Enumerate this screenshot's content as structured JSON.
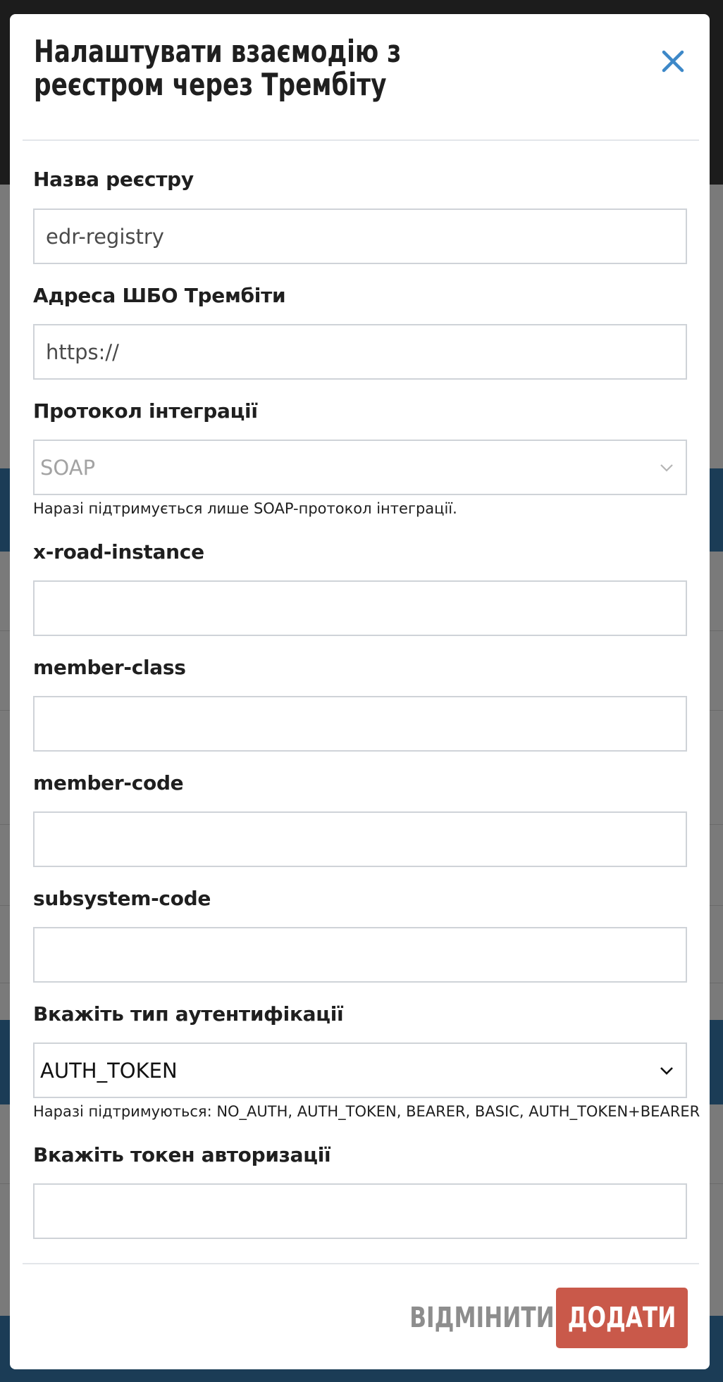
{
  "modal": {
    "title": "Налаштувати взаємодію з реєстром через Трембіту",
    "fields": {
      "registry_name": {
        "label": "Назва реєстру",
        "value": "edr-registry"
      },
      "trembita_address": {
        "label": "Адреса ШБО Трембіти",
        "value": "https://"
      },
      "protocol": {
        "label": "Протокол інтеграції",
        "selected": "SOAP",
        "hint": "Наразі підтримується лише SOAP-протокол інтеграції."
      },
      "x_road_instance": {
        "label": "x-road-instance",
        "value": ""
      },
      "member_class": {
        "label": "member-class",
        "value": ""
      },
      "member_code": {
        "label": "member-code",
        "value": ""
      },
      "subsystem_code": {
        "label": "subsystem-code",
        "value": ""
      },
      "auth_type": {
        "label": "Вкажіть тип аутентифікації",
        "selected": "AUTH_TOKEN",
        "hint": "Наразі підтримуються: NO_AUTH, AUTH_TOKEN, BEARER, BASIC, AUTH_TOKEN+BEARER"
      },
      "auth_token": {
        "label": "Вкажіть токен авторизації",
        "value": ""
      }
    },
    "buttons": {
      "cancel": "ВІДМІНИТИ",
      "add": "ДОДАТИ"
    }
  },
  "colors": {
    "accent_close": "#3d88c8",
    "primary_button": "#c9594a",
    "cancel_text": "#8d8d8d",
    "border": "#cfd3d8"
  },
  "icons": {
    "close": "close-icon",
    "select_arrow": "chevron-down-icon"
  }
}
